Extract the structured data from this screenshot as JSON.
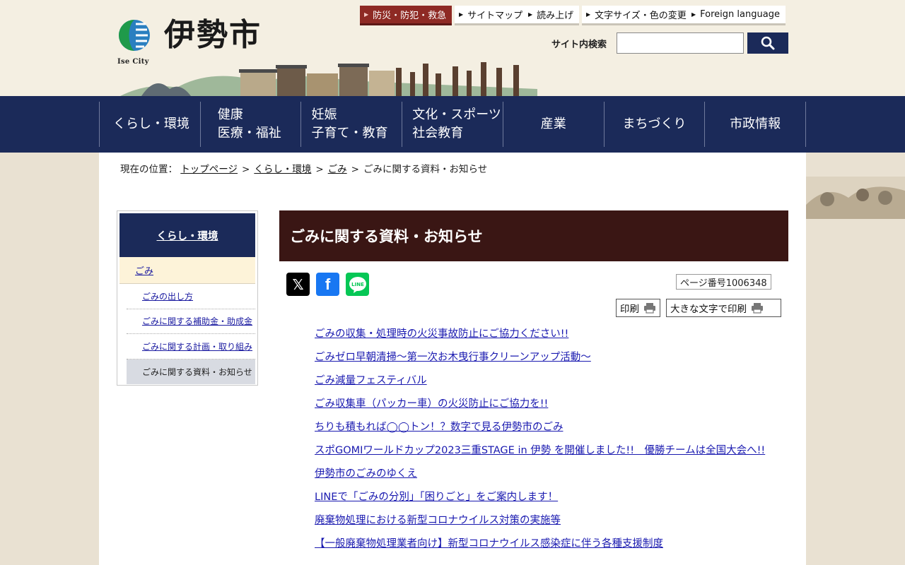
{
  "site": {
    "logo_sub": "Ise City",
    "logo_title": "伊勢市"
  },
  "utility": {
    "disaster": "防災・防犯・救急",
    "sitemap": "サイトマップ",
    "read_aloud": "読み上げ",
    "text_size": "文字サイズ・色の変更",
    "foreign": "Foreign language"
  },
  "search": {
    "label": "サイト内検索",
    "value": "",
    "placeholder": ""
  },
  "gnav": [
    {
      "lines": [
        "くらし・環境"
      ]
    },
    {
      "lines": [
        "健康",
        "医療・福祉"
      ]
    },
    {
      "lines": [
        "妊娠",
        "子育て・教育"
      ]
    },
    {
      "lines": [
        "文化・スポーツ",
        "社会教育"
      ]
    },
    {
      "lines": [
        "産業"
      ]
    },
    {
      "lines": [
        "まちづくり"
      ]
    },
    {
      "lines": [
        "市政情報"
      ]
    }
  ],
  "breadcrumb": {
    "prefix": "現在の位置：",
    "items": [
      "トップページ",
      "くらし・環境",
      "ごみ"
    ],
    "sep": ">",
    "current": "ごみに関する資料・お知らせ"
  },
  "sidenav": {
    "head": "くらし・環境",
    "current": "ごみ",
    "items": [
      "ごみの出し方",
      "ごみに関する補助金・助成金",
      "ごみに関する計画・取り組み",
      "ごみに関する資料・お知らせ"
    ]
  },
  "page": {
    "title": "ごみに関する資料・お知らせ",
    "page_number": "ページ番号1006348",
    "print": "印刷",
    "print_large": "大きな文字で印刷"
  },
  "sns": {
    "x": "𝕏",
    "facebook": "f",
    "line": "LINE"
  },
  "articles": [
    "ごみの収集・処理時の火災事故防止にご協力ください!!",
    "ごみゼロ早朝清掃～第一次お木曳行事クリーンアップ活動～",
    "ごみ減量フェスティバル",
    "ごみ収集車（パッカー車）の火災防止にご協力を!!",
    "ちりも積もれば◯◯トン！？数字で見る伊勢市のごみ",
    "スポGOMIワールドカップ2023三重STAGE in 伊勢 を開催しました!!　優勝チームは全国大会へ!!",
    "伊勢市のごみのゆくえ",
    "LINEで「ごみの分別」「困りごと」をご案内します！",
    "廃棄物処理における新型コロナウイルス対策の実施等",
    "【一般廃棄物処理業者向け】新型コロナウイルス感染症に伴う各種支援制度"
  ],
  "colors": {
    "navy": "#1b2a59",
    "title_bg": "#3a1614",
    "disaster": "#8e2a24",
    "link": "#1a1ab0"
  }
}
